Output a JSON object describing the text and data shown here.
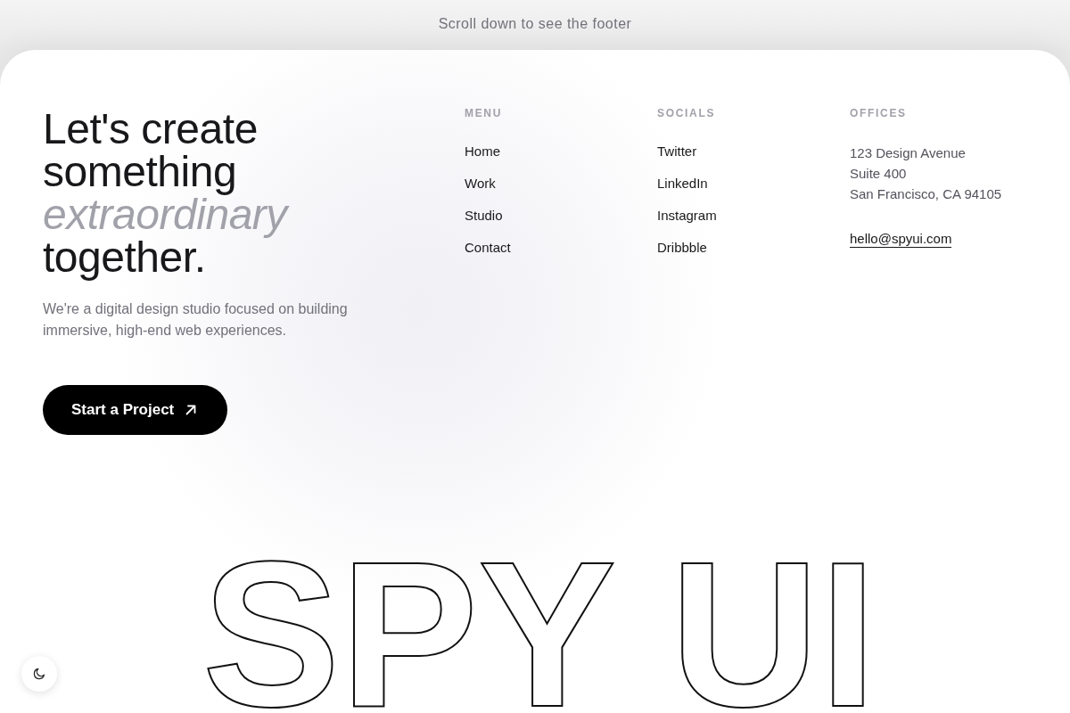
{
  "banner": {
    "text": "Scroll down to see the footer"
  },
  "hero": {
    "heading": "Let's create something *extraordinary* together.",
    "description": "We're a digital design studio focused on building immersive, high-end web experiences.",
    "button": {
      "label": "Start a Project"
    }
  },
  "columns": [
    {
      "kind": "links",
      "title": "MENU",
      "items": [
        "Home",
        "Work",
        "Studio",
        "Contact"
      ]
    },
    {
      "kind": "links",
      "title": "SOCIALS",
      "items": [
        "Twitter",
        "LinkedIn",
        "Instagram",
        "Dribbble"
      ]
    },
    {
      "kind": "address",
      "title": "OFFICES",
      "lines": [
        "123 Design Avenue",
        "Suite 400",
        "San Francisco, CA 94105"
      ],
      "email": "hello@spyui.com"
    }
  ],
  "wordmark": "SPY UI"
}
